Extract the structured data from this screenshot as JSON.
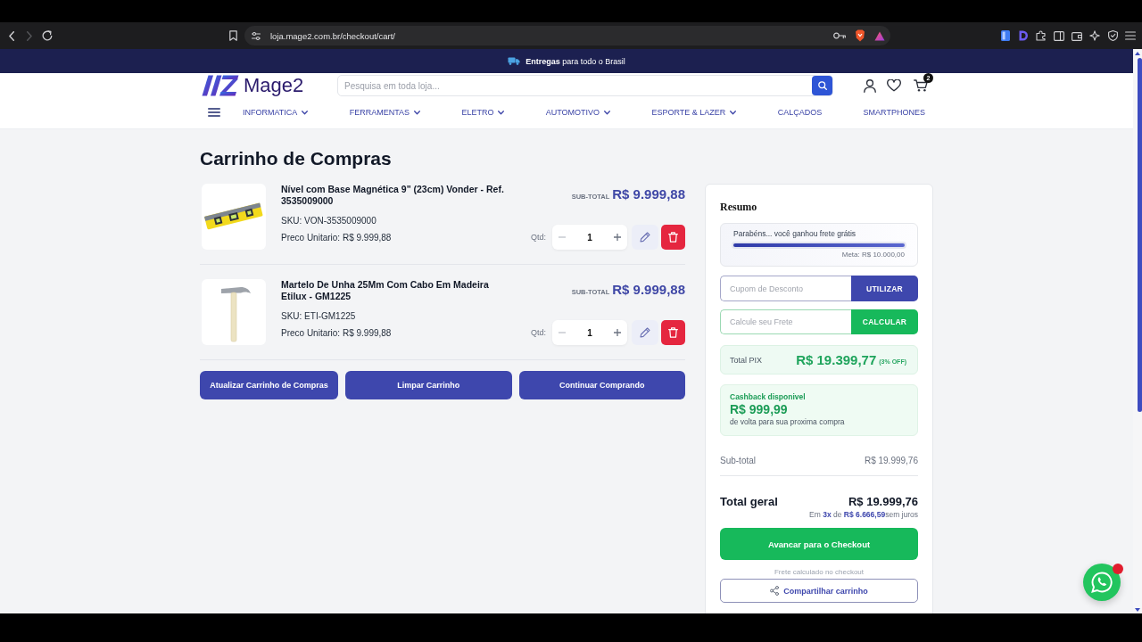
{
  "browser": {
    "url": "loja.mage2.com.br/checkout/cart/",
    "forward_enabled": false
  },
  "announcement": {
    "text": "**Entregas** para todo o Brasil"
  },
  "header": {
    "logo": "Mage2",
    "search": {
      "placeholder": "Pesquisa em toda loja..."
    },
    "cart_count": "2"
  },
  "nav": [
    {
      "label": "INFORMATICA",
      "dropdown": true
    },
    {
      "label": "FERRAMENTAS",
      "dropdown": true
    },
    {
      "label": "ELETRO",
      "dropdown": true
    },
    {
      "label": "AUTOMOTIVO",
      "dropdown": true
    },
    {
      "label": "ESPORTE & LAZER",
      "dropdown": true
    },
    {
      "label": "CALÇADOS",
      "dropdown": false
    },
    {
      "label": "SMARTPHONES",
      "dropdown": false
    }
  ],
  "page_title": "Carrinho de Compras",
  "cart": {
    "items": [
      {
        "kind": "level",
        "name": "Nível com Base Magnética 9\" (23cm) Vonder - Ref. 3535009000",
        "sku": "SKU: VON-3535009000",
        "unit_price": "Preco Unitario: R$ 9.999,88",
        "subtotal_label": "SUB-TOTAL",
        "subtotal": "R$ 9.999,88",
        "qty_label": "Qtd:",
        "qty": "1"
      },
      {
        "kind": "hammer",
        "name": "Martelo De Unha 25Mm Com Cabo Em Madeira Etilux - GM1225",
        "sku": "SKU: ETI-GM1225",
        "unit_price": "Preco Unitario: R$ 9.999,88",
        "subtotal_label": "SUB-TOTAL",
        "subtotal": "R$ 9.999,88",
        "qty_label": "Qtd:",
        "qty": "1"
      }
    ],
    "buttons": [
      "Atualizar Carrinho de Compras",
      "Limpar Carrinho",
      "Continuar Comprando"
    ]
  },
  "summary": {
    "title": "Resumo",
    "free_shipping": {
      "message": "Parabéns... você ganhou frete grátis",
      "level": 1,
      "goal": "Meta: R$ 10.000,00"
    },
    "coupon": {
      "placeholder": "Cupom de Desconto",
      "button": "UTILIZAR"
    },
    "shipping": {
      "placeholder": "Calcule seu Frete",
      "button": "CALCULAR"
    },
    "pix": {
      "label": "Total PIX",
      "amount": "R$ 19.399,77",
      "discount": "(3% OFF)"
    },
    "cashback": {
      "title": "Cashback disponivel",
      "amount": "R$ 999,99",
      "note": "de volta para sua proxima compra"
    },
    "subtotal": {
      "label": "Sub-total",
      "value": "R$ 19.999,76"
    },
    "total": {
      "label": "Total geral",
      "value": "R$ 19.999,76",
      "installments": "Em **3x** de **R$ 6.666,59**sem juros"
    },
    "checkout_button": "Avancar para o Checkout",
    "shipping_note": "Frete calculado no checkout",
    "share_button": "Compartilhar carrinho"
  }
}
